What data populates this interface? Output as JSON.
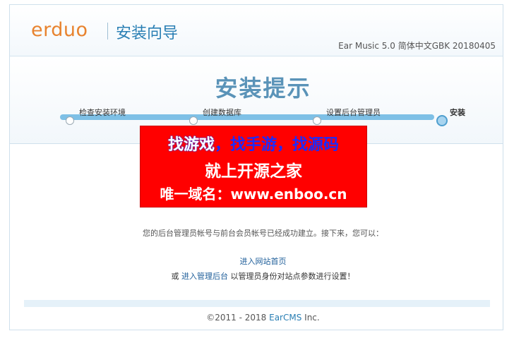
{
  "header": {
    "logo": "erduo",
    "title": "安装向导",
    "version": "Ear Music 5.0 简体中文GBK 20180405"
  },
  "page_heading": "安装提示",
  "steps": [
    {
      "label": "检查安装环境",
      "state": "done"
    },
    {
      "label": "创建数据库",
      "state": "done"
    },
    {
      "label": "设置后台管理员",
      "state": "done"
    },
    {
      "label": "安装",
      "state": "active"
    }
  ],
  "ad": {
    "line1_a": "找游戏",
    "line1_b": "，找手游，找源码",
    "line2": "就上开源之家",
    "line3": "唯一域名：www.enboo.cn"
  },
  "message": "您的后台管理员帐号与前台会员帐号已经成功建立。接下来，您可以：",
  "home_link": "进入网站首页",
  "admin": {
    "prefix": "或",
    "link": "进入管理后台",
    "suffix": "以管理员身份对站点参数进行设置！"
  },
  "footer": {
    "copyright_prefix": "©2011 - 2018 ",
    "brand": "EarCMS",
    "copyright_suffix": " Inc."
  },
  "colors": {
    "logo": "#e8832f",
    "accent": "#2a7fb4",
    "progress": "#7ec0e6",
    "ad_background": "#ff0000"
  }
}
